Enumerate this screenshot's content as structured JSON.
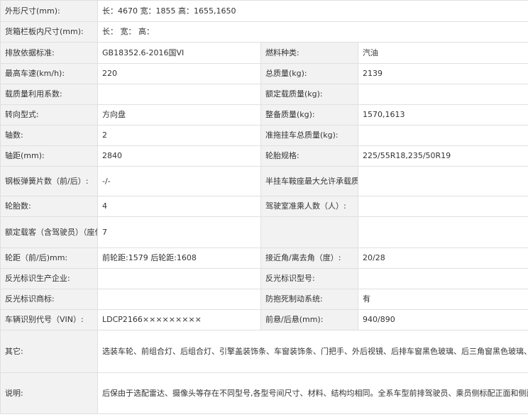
{
  "rows": [
    {
      "label": "外形尺寸(mm):",
      "value": "长：4670 宽：1855 高：1655,1650"
    },
    {
      "label": "货箱栏板内尺寸(mm):",
      "value": "长： 宽： 高："
    },
    {
      "label1": "排放依据标准:",
      "value1": "GB18352.6-2016国VI",
      "label2": "燃料种类:",
      "value2": "汽油"
    },
    {
      "label1": "最高车速(km/h):",
      "value1": "220",
      "label2": "总质量(kg):",
      "value2": "2139"
    },
    {
      "label1": "载质量利用系数:",
      "value1": "",
      "label2": "额定载质量(kg):",
      "value2": ""
    },
    {
      "label1": "转向型式:",
      "value1": "方向盘",
      "label2": "整备质量(kg):",
      "value2": "1570,1613"
    },
    {
      "label1": "轴数:",
      "value1": "2",
      "label2": "准拖挂车总质量(kg):",
      "value2": ""
    },
    {
      "label1": "轴距(mm):",
      "value1": "2840",
      "label2": "轮胎规格:",
      "value2": "225/55R18,235/50R19"
    },
    {
      "label1": "钢板弹簧片数（前/后）:",
      "value1": "-/-",
      "label2": "半挂车鞍座最大允许承载质量(kg):",
      "value2": ""
    },
    {
      "label1": "轮胎数:",
      "value1": "4",
      "label2": "驾驶室准乘人数（人）:",
      "value2": ""
    },
    {
      "label1": "额定载客（含驾驶员）（座位数）:",
      "value1": "7",
      "label2": "",
      "value2": ""
    },
    {
      "label1": "轮距（前/后)mm:",
      "value1": "前轮距:1579 后轮距:1608",
      "label2": "接近角/离去角（度）:",
      "value2": "20/28"
    },
    {
      "label1": "反光标识生产企业:",
      "value1": "",
      "label2": "反光标识型号:",
      "value2": ""
    },
    {
      "label1": "反光标识商标:",
      "value1": "",
      "label2": "防抱死制动系统:",
      "value2": "有"
    },
    {
      "label1": "车辆识别代号（VIN）:",
      "value1": "LDCP2166×××××××××",
      "label2": "前悬/后悬(mm):",
      "value2": "940/890"
    },
    {
      "label": "其它:",
      "value": "选装车轮、前组合灯、后组合灯、引擎盖装饰条、车窗装饰条、门把手、外后视镜、后排车窗黑色玻璃、后三角窗黑色玻璃、后背门黑色玻璃、车顶行李架、黑色车顶、黑色后扰流板、全景天窗、标识。ABS型号:ESP9,生产厂家:博世汽车部件(苏州)有限公司。发动机最大净功率为155kW。该车型可选装ETC车载装置。"
    },
    {
      "label": "说明:",
      "value": "后保由于选配雷达、摄像头等存在不同型号,各型号间尺寸、材料、结构均相同。全系车型前排驾驶员、乘员侧标配正面和侧面气囊,标配贯穿前后排的安全气帘。前排座椅存在6向手动座椅、6向电动、8向电动座椅3种型号。两种型号的前照灯,前转向灯、前位灯、日间行驶灯为复合灯，且与前照灯搭配装车。两个整备质量，对应的油耗均为6.5。"
    }
  ]
}
